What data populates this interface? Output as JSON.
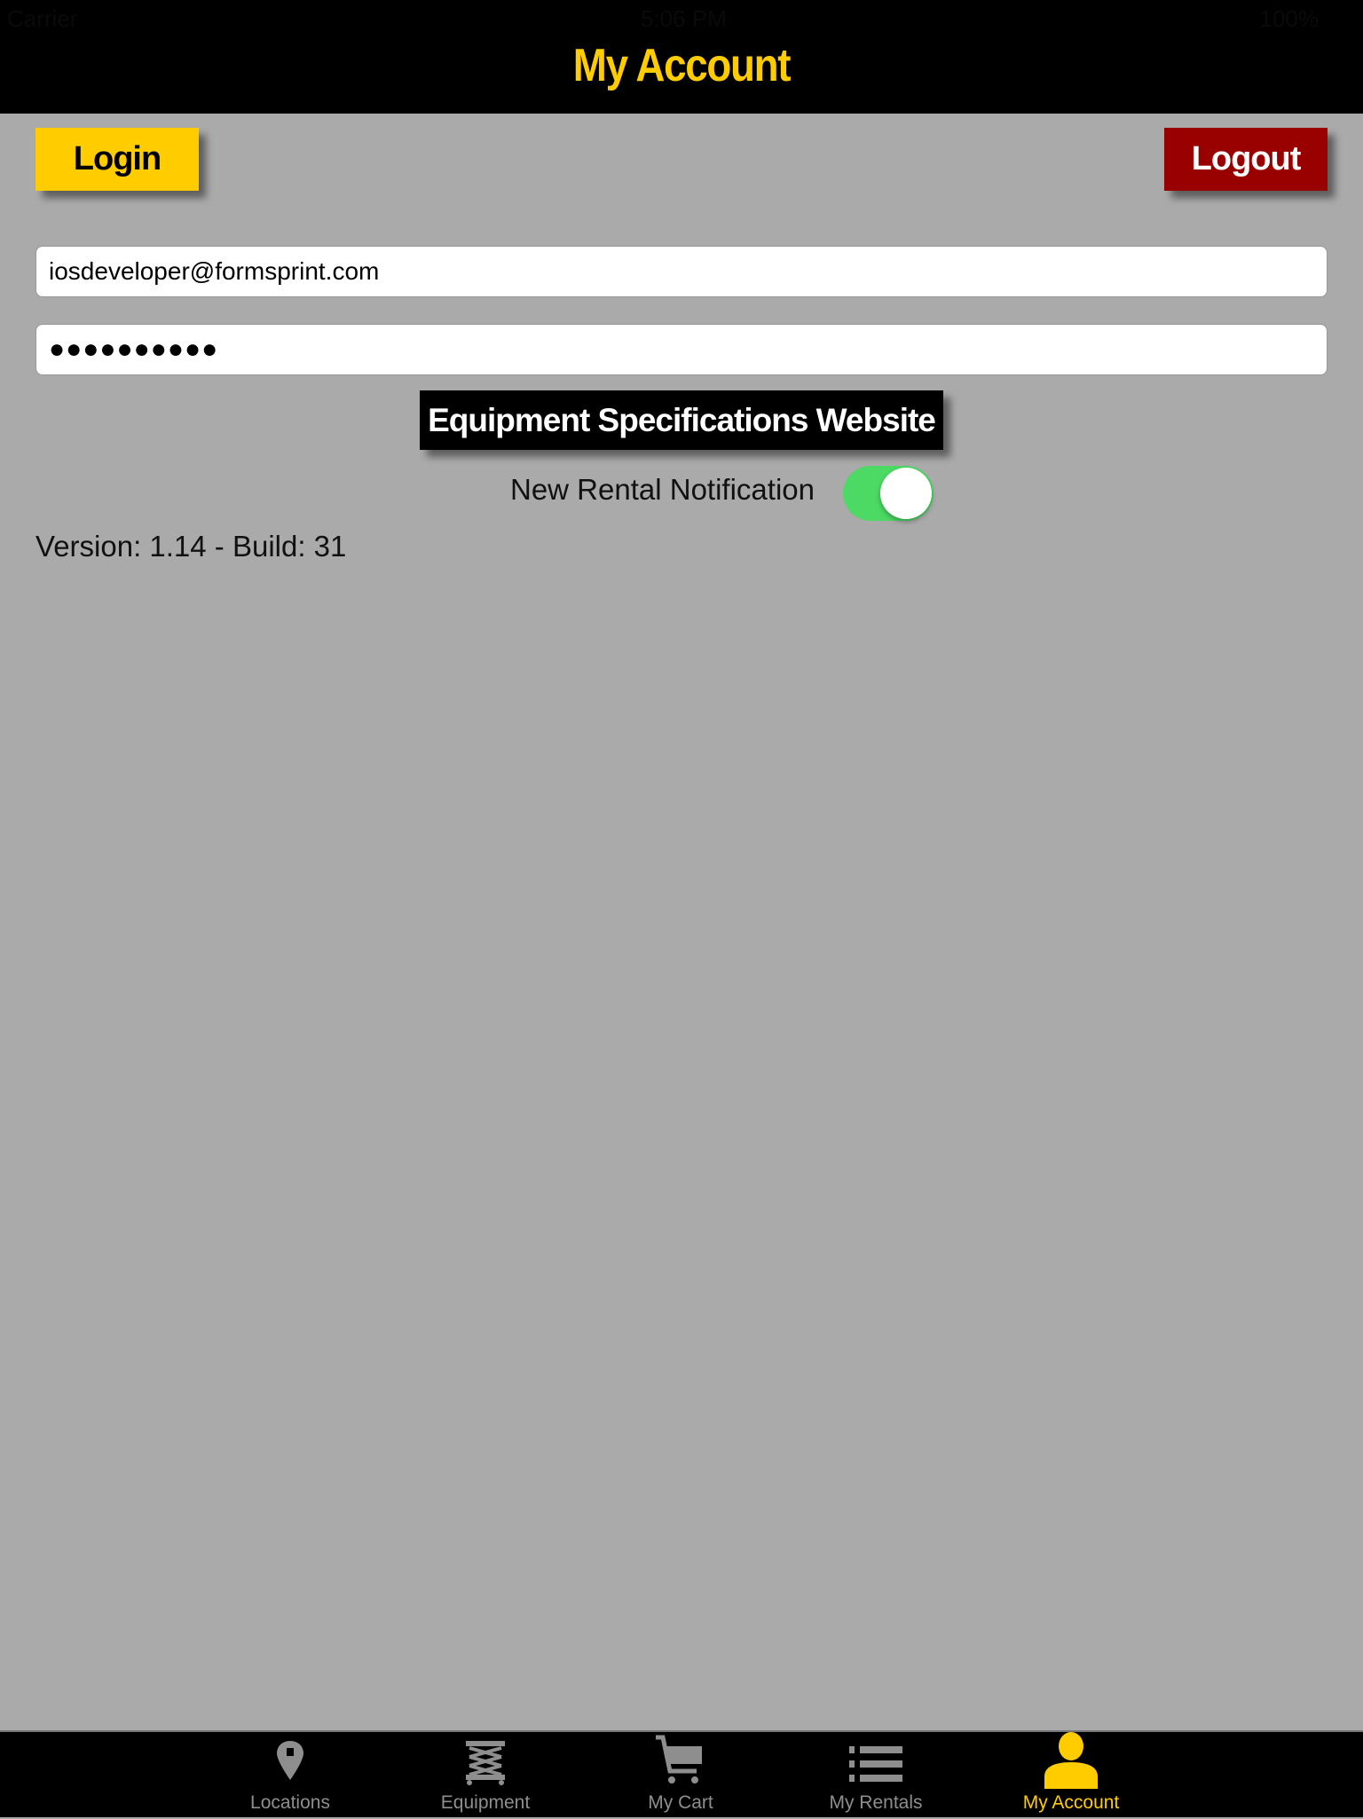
{
  "status_bar": {
    "carrier": "Carrier",
    "time": "5:06 PM",
    "battery": "100%"
  },
  "header": {
    "title": "My Account"
  },
  "buttons": {
    "login": "Login",
    "logout": "Logout",
    "specs": "Equipment Specifications Website"
  },
  "form": {
    "email": "iosdeveloper@formsprint.com",
    "password_masked": "●●●●●●●●●●"
  },
  "notification": {
    "label": "New Rental Notification",
    "enabled": true
  },
  "version": "Version: 1.14 - Build: 31",
  "colors": {
    "accent": "#ffcc00",
    "logout": "#990000",
    "toggle_on": "#4cd964",
    "background": "#aaaaaa"
  },
  "tabs": [
    {
      "label": "Locations",
      "icon": "map-pin-icon"
    },
    {
      "label": "Equipment",
      "icon": "scissor-lift-icon"
    },
    {
      "label": "My Cart",
      "icon": "cart-icon"
    },
    {
      "label": "My Rentals",
      "icon": "list-icon"
    },
    {
      "label": "My Account",
      "icon": "person-icon",
      "active": true
    }
  ]
}
